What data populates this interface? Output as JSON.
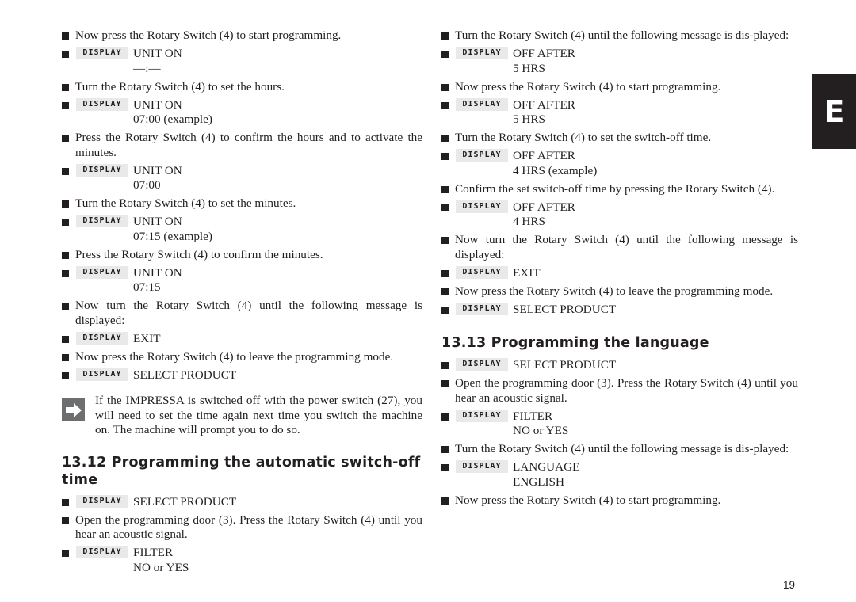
{
  "display_badge_label": "DISPLAY",
  "side_tab": "E",
  "page_number": "19",
  "left_column": {
    "blocks": [
      {
        "type": "step",
        "text": "Now press the Rotary Switch (4) to start programming."
      },
      {
        "type": "display",
        "lines": [
          "UNIT ON",
          "—:—"
        ]
      },
      {
        "type": "step",
        "text": "Turn the Rotary Switch (4) to set the hours."
      },
      {
        "type": "display",
        "lines": [
          "UNIT ON",
          "07:00 (example)"
        ]
      },
      {
        "type": "step",
        "text": "Press the Rotary Switch (4) to confirm the hours and to activate the minutes."
      },
      {
        "type": "display",
        "lines": [
          "UNIT ON",
          "07:00"
        ]
      },
      {
        "type": "step",
        "text": "Turn the Rotary Switch (4) to set the minutes."
      },
      {
        "type": "display",
        "lines": [
          "UNIT ON",
          "07:15 (example)"
        ]
      },
      {
        "type": "step",
        "text": "Press the Rotary Switch (4) to confirm the minutes."
      },
      {
        "type": "display",
        "lines": [
          "UNIT ON",
          "07:15"
        ]
      },
      {
        "type": "step",
        "text": "Now turn the Rotary Switch (4) until the following message is displayed:"
      },
      {
        "type": "display",
        "lines": [
          "EXIT"
        ]
      },
      {
        "type": "step",
        "text": "Now press the Rotary Switch (4) to leave the programming mode."
      },
      {
        "type": "display",
        "lines": [
          "SELECT PRODUCT"
        ]
      },
      {
        "type": "note",
        "text": "If the IMPRESSA is switched off with the power switch (27), you will need to set the time again next time you switch the machine on. The machine will prompt you to do so."
      },
      {
        "type": "heading",
        "text": "13.12 Programming the automatic switch-off time"
      },
      {
        "type": "display",
        "lines": [
          "SELECT PRODUCT"
        ]
      },
      {
        "type": "step",
        "text": "Open the programming door (3). Press the Rotary Switch (4) until you hear an acoustic signal."
      },
      {
        "type": "display",
        "lines": [
          "FILTER",
          "NO or YES"
        ]
      }
    ]
  },
  "right_column": {
    "blocks": [
      {
        "type": "step",
        "text": "Turn the Rotary Switch (4) until the following message is dis-played:"
      },
      {
        "type": "display",
        "lines": [
          "OFF AFTER",
          "5 HRS"
        ]
      },
      {
        "type": "step",
        "text": "Now press the Rotary Switch (4) to start programming."
      },
      {
        "type": "display",
        "lines": [
          "OFF AFTER",
          "5 HRS"
        ]
      },
      {
        "type": "step",
        "text": "Turn the Rotary Switch (4) to set the switch-off time."
      },
      {
        "type": "display",
        "lines": [
          "OFF AFTER",
          "4 HRS (example)"
        ]
      },
      {
        "type": "step",
        "text": "Confirm the set switch-off time by pressing the Rotary Switch (4)."
      },
      {
        "type": "display",
        "lines": [
          "OFF AFTER",
          "4 HRS"
        ]
      },
      {
        "type": "step",
        "text": "Now turn the Rotary Switch (4) until the following message is displayed:"
      },
      {
        "type": "display",
        "lines": [
          "EXIT"
        ]
      },
      {
        "type": "step",
        "text": "Now press the Rotary Switch (4) to leave the programming mode."
      },
      {
        "type": "display",
        "lines": [
          "SELECT PRODUCT"
        ]
      },
      {
        "type": "heading",
        "text": "13.13 Programming the language"
      },
      {
        "type": "display",
        "lines": [
          "SELECT PRODUCT"
        ]
      },
      {
        "type": "step",
        "text": "Open the programming door (3). Press the Rotary Switch (4) until you hear an acoustic signal."
      },
      {
        "type": "display",
        "lines": [
          "FILTER",
          "NO or YES"
        ]
      },
      {
        "type": "step",
        "text": "Turn the Rotary Switch (4) until the following message is dis-played:"
      },
      {
        "type": "display",
        "lines": [
          "LANGUAGE",
          "ENGLISH"
        ]
      },
      {
        "type": "step",
        "text": "Now press the Rotary Switch (4) to start programming."
      }
    ]
  }
}
